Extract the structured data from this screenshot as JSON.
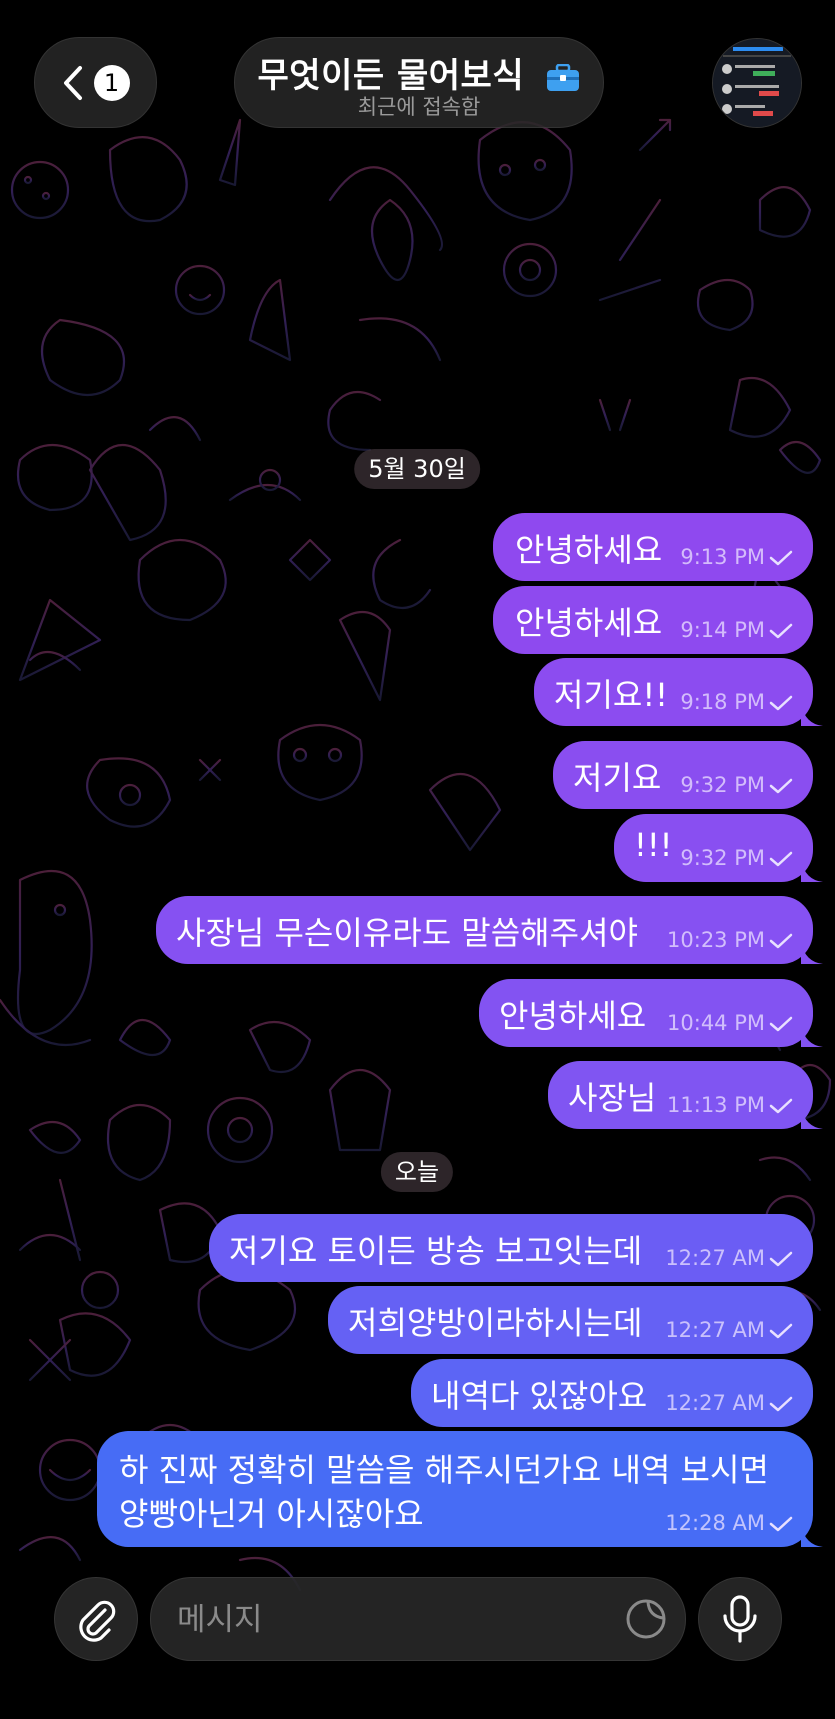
{
  "header": {
    "back_badge": "1",
    "title": "무엇이든 물어보식",
    "status": "최근에 접속함"
  },
  "dates": {
    "first": "5월 30일",
    "today": "오늘"
  },
  "messages": [
    {
      "text": "안녕하세요",
      "time": "9:13 PM"
    },
    {
      "text": "안녕하세요",
      "time": "9:14 PM"
    },
    {
      "text": "저기요!!",
      "time": "9:18 PM"
    },
    {
      "text": "저기요",
      "time": "9:32 PM"
    },
    {
      "text": "!!!",
      "time": "9:32 PM"
    },
    {
      "text": "사장님 무슨이유라도 말씀해주셔야",
      "time": "10:23 PM"
    },
    {
      "text": "안녕하세요",
      "time": "10:44 PM"
    },
    {
      "text": "사장님",
      "time": "11:13 PM"
    },
    {
      "text": "저기요 토이든 방송 보고잇는데",
      "time": "12:27 AM"
    },
    {
      "text": "저희양방이라하시는데",
      "time": "12:27 AM"
    },
    {
      "text": "내역다 있잖아요",
      "time": "12:27 AM"
    },
    {
      "text_line1": "하 진짜 정확히 말씀을 해주시던가요 내역 보시면",
      "text_line2": "양빵아닌거 아시잖아요",
      "time": "12:28 AM"
    }
  ],
  "composer": {
    "placeholder": "메시지"
  },
  "colors": {
    "bubble_top": "#8a4df0",
    "bubble_bottom": "#3f6cf5",
    "background": "#000000",
    "doodle": "#6a3a8a"
  }
}
